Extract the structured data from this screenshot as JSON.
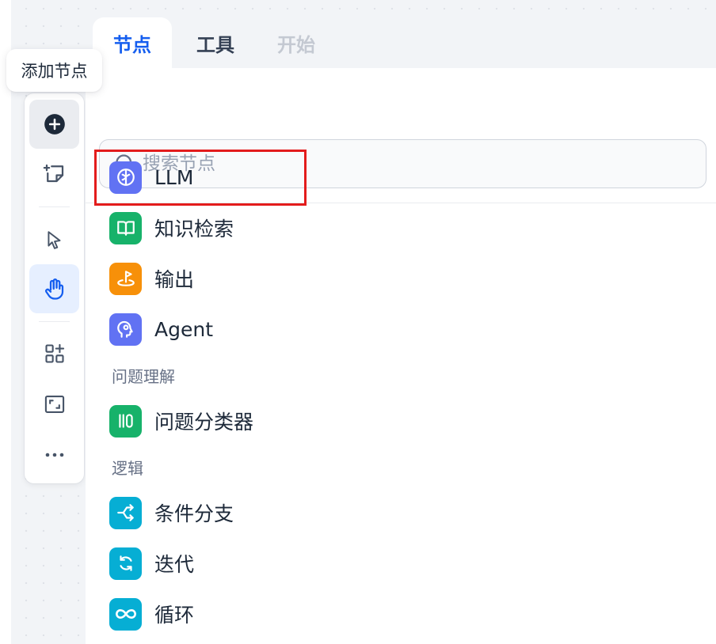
{
  "tooltip": {
    "text": "添加节点"
  },
  "toolbar": {
    "buttons": [
      {
        "name": "add-node",
        "icon": "plus-circle-icon"
      },
      {
        "name": "add-note",
        "icon": "note-add-icon"
      },
      {
        "name": "pointer",
        "icon": "cursor-icon"
      },
      {
        "name": "hand",
        "icon": "hand-icon"
      },
      {
        "name": "organize",
        "icon": "grid-plus-icon"
      },
      {
        "name": "fit-view",
        "icon": "frame-icon"
      },
      {
        "name": "more",
        "icon": "more-dots-icon"
      }
    ]
  },
  "tabs": [
    {
      "label": "节点",
      "active": true
    },
    {
      "label": "工具",
      "active": false
    },
    {
      "label": "开始",
      "active": false,
      "disabled": true
    }
  ],
  "search": {
    "placeholder": "搜索节点",
    "value": ""
  },
  "items": {
    "llm": {
      "label": "LLM",
      "icon": "brain-icon",
      "color": "#6172f3"
    },
    "knowledge": {
      "label": "知识检索",
      "icon": "book-icon",
      "color": "#17b26a"
    },
    "output": {
      "label": "输出",
      "icon": "flag-icon",
      "color": "#f79009"
    },
    "agent": {
      "label": "Agent",
      "icon": "agent-head-icon",
      "color": "#6172f3"
    },
    "classifier": {
      "label": "问题分类器",
      "icon": "classifier-icon",
      "color": "#17b26a"
    },
    "ifelse": {
      "label": "条件分支",
      "icon": "branch-icon",
      "color": "#06aed4"
    },
    "iteration": {
      "label": "迭代",
      "icon": "repeat-icon",
      "color": "#06aed4"
    },
    "loop": {
      "label": "循环",
      "icon": "infinity-icon",
      "color": "#06aed4"
    }
  },
  "sections": {
    "understanding": "问题理解",
    "logic": "逻辑"
  },
  "colors": {
    "accent": "#155eef",
    "highlight": "#e31c1c"
  }
}
